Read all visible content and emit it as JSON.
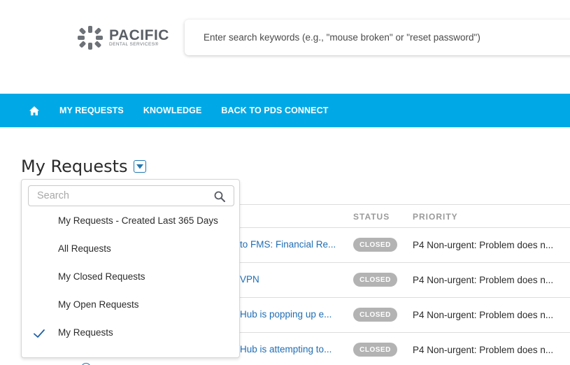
{
  "header": {
    "logo": {
      "name": "PACIFIC",
      "subtitle": "DENTAL SERVICES®"
    },
    "search_placeholder": "Enter search keywords (e.g., \"mouse broken\" or \"reset password\")"
  },
  "nav": {
    "items": [
      {
        "label": "MY REQUESTS"
      },
      {
        "label": "KNOWLEDGE"
      },
      {
        "label": "BACK TO PDS CONNECT"
      }
    ]
  },
  "page": {
    "title": "My Requests"
  },
  "table": {
    "columns": {
      "status": "STATUS",
      "priority": "PRIORITY"
    },
    "rows": [
      {
        "subject": "to FMS: Financial Re...",
        "status": "CLOSED",
        "priority": "P4 Non-urgent: Problem does n..."
      },
      {
        "subject": "VPN",
        "status": "CLOSED",
        "priority": "P4 Non-urgent: Problem does n..."
      },
      {
        "subject": "Hub is popping up e...",
        "status": "CLOSED",
        "priority": "P4 Non-urgent: Problem does n..."
      },
      {
        "subject": "Hub is attempting to...",
        "status": "CLOSED",
        "priority": "P4 Non-urgent: Problem does n..."
      }
    ]
  },
  "dropdown": {
    "search_placeholder": "Search",
    "items": [
      {
        "label": "My Requests - Created Last 365 Days",
        "selected": false
      },
      {
        "label": "All Requests",
        "selected": false
      },
      {
        "label": "My Closed Requests",
        "selected": false
      },
      {
        "label": "My Open Requests",
        "selected": false
      },
      {
        "label": "My Requests",
        "selected": true
      }
    ]
  },
  "colors": {
    "nav": "#00a9e6",
    "link": "#1f6db4",
    "status_badge": "#b3b3b3",
    "check": "#1f78b4"
  },
  "icons": [
    "home-icon",
    "chevron-down-icon",
    "search-icon",
    "checkmark-icon"
  ]
}
